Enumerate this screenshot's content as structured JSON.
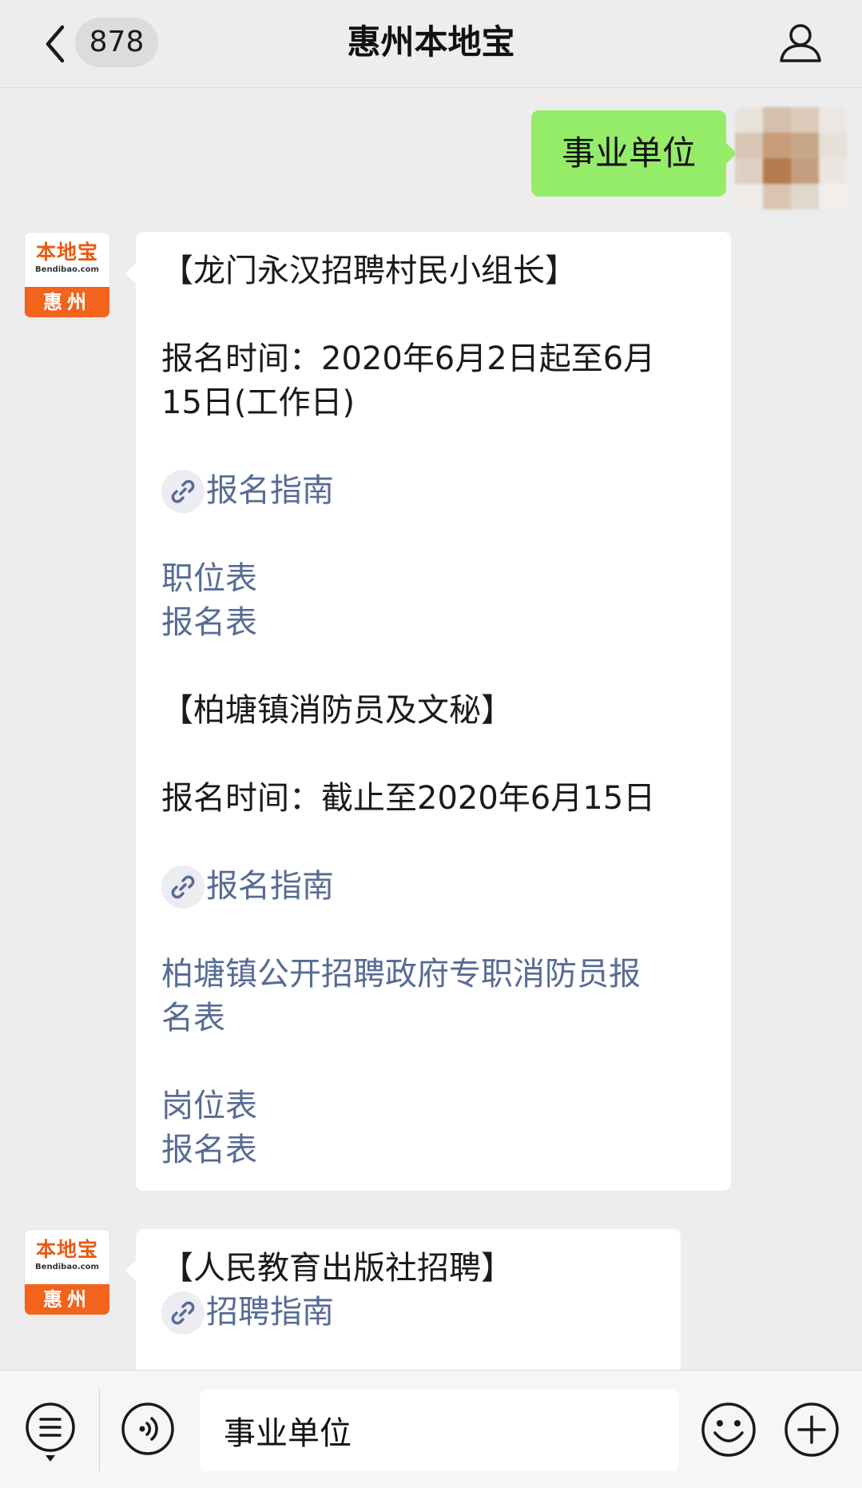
{
  "header": {
    "unread_count": "878",
    "title": "惠州本地宝"
  },
  "sent_message": {
    "text": "事业单位"
  },
  "official_account": {
    "brand": "本地宝",
    "domain": "Bendibao.com",
    "city": "惠州"
  },
  "message1": {
    "section1_title": "【龙门永汉招聘村民小组长】",
    "section1_time_line1": "报名时间：2020年6月2日起至6月",
    "section1_time_line2": "15日(工作日)",
    "section1_guide": "报名指南",
    "section1_link1": "职位表",
    "section1_link2": "报名表",
    "section2_title": "【柏塘镇消防员及文秘】",
    "section2_time": "报名时间：截止至2020年6月15日",
    "section2_guide": "报名指南",
    "section2_link1_line1": "柏塘镇公开招聘政府专职消防员报",
    "section2_link1_line2": "名表",
    "section2_link2": "岗位表",
    "section2_link3": "报名表"
  },
  "message2": {
    "title": "【人民教育出版社招聘】",
    "guide": "招聘指南"
  },
  "input_bar": {
    "value": "事业单位"
  },
  "colors": {
    "sent_bubble": "#95ec69",
    "link": "#576b95",
    "brand_orange": "#f2631c",
    "background": "#ededed"
  }
}
